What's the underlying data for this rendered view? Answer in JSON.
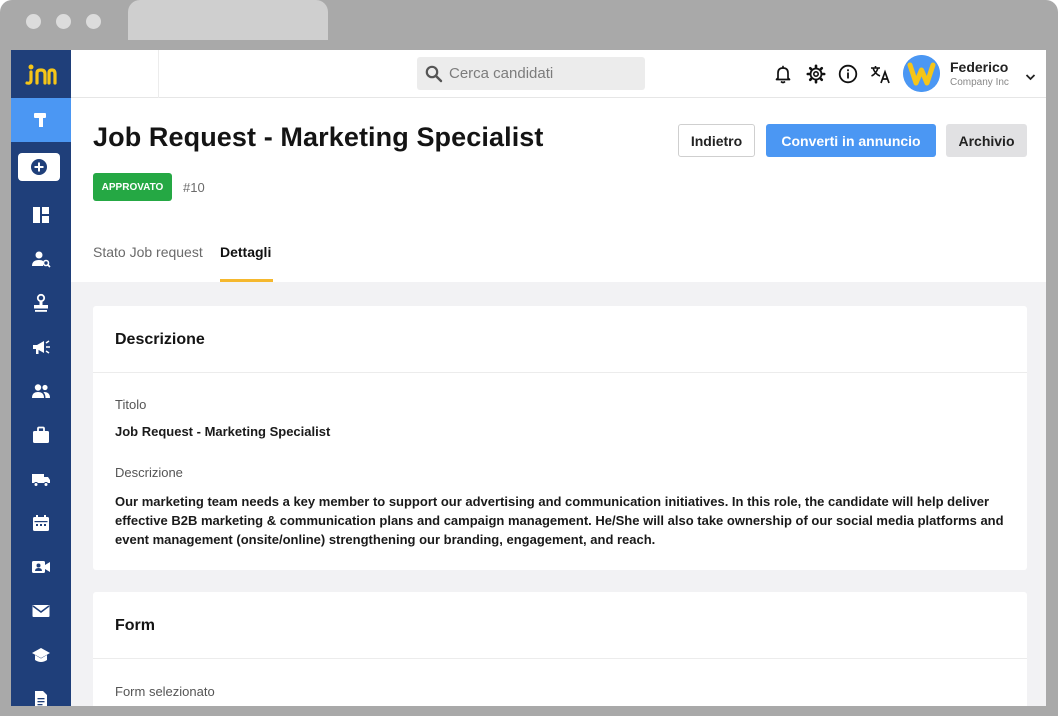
{
  "app": {
    "search": {
      "placeholder": "Cerca candidati"
    },
    "user": {
      "name": "Federico",
      "company": "Company Inc"
    }
  },
  "sidebar": {
    "items": [
      {
        "name": "dashboard"
      },
      {
        "name": "candidates-search"
      },
      {
        "name": "stamp"
      },
      {
        "name": "announcements"
      },
      {
        "name": "team"
      },
      {
        "name": "jobs"
      },
      {
        "name": "shipping"
      },
      {
        "name": "calendar"
      },
      {
        "name": "video-interview"
      },
      {
        "name": "mail"
      },
      {
        "name": "school"
      },
      {
        "name": "documents"
      }
    ]
  },
  "header": {
    "title": "Job Request - Marketing Specialist",
    "status": "APPROVATO",
    "id": "#10",
    "buttons": {
      "back": "Indietro",
      "convert": "Converti in annuncio",
      "archive": "Archivio"
    },
    "tabs": {
      "status": "Stato Job request",
      "details": "Dettagli"
    }
  },
  "description_card": {
    "title": "Descrizione",
    "title_label": "Titolo",
    "title_value": "Job Request - Marketing Specialist",
    "desc_label": "Descrizione",
    "desc_value": "Our marketing team needs a key member to support our advertising and communication initiatives. In this role, the candidate will help deliver effective B2B marketing & communication plans and campaign management. He/She will also take ownership of our social media platforms and event management (onsite/online) strengthening our branding, engagement, and reach."
  },
  "form_card": {
    "title": "Form",
    "selected_label": "Form selezionato"
  },
  "colors": {
    "sidebar": "#1f3f7a",
    "accent": "#4b97f3",
    "approved": "#25a844",
    "tab_underline": "#f5b82e",
    "logo": "#f5c518"
  }
}
